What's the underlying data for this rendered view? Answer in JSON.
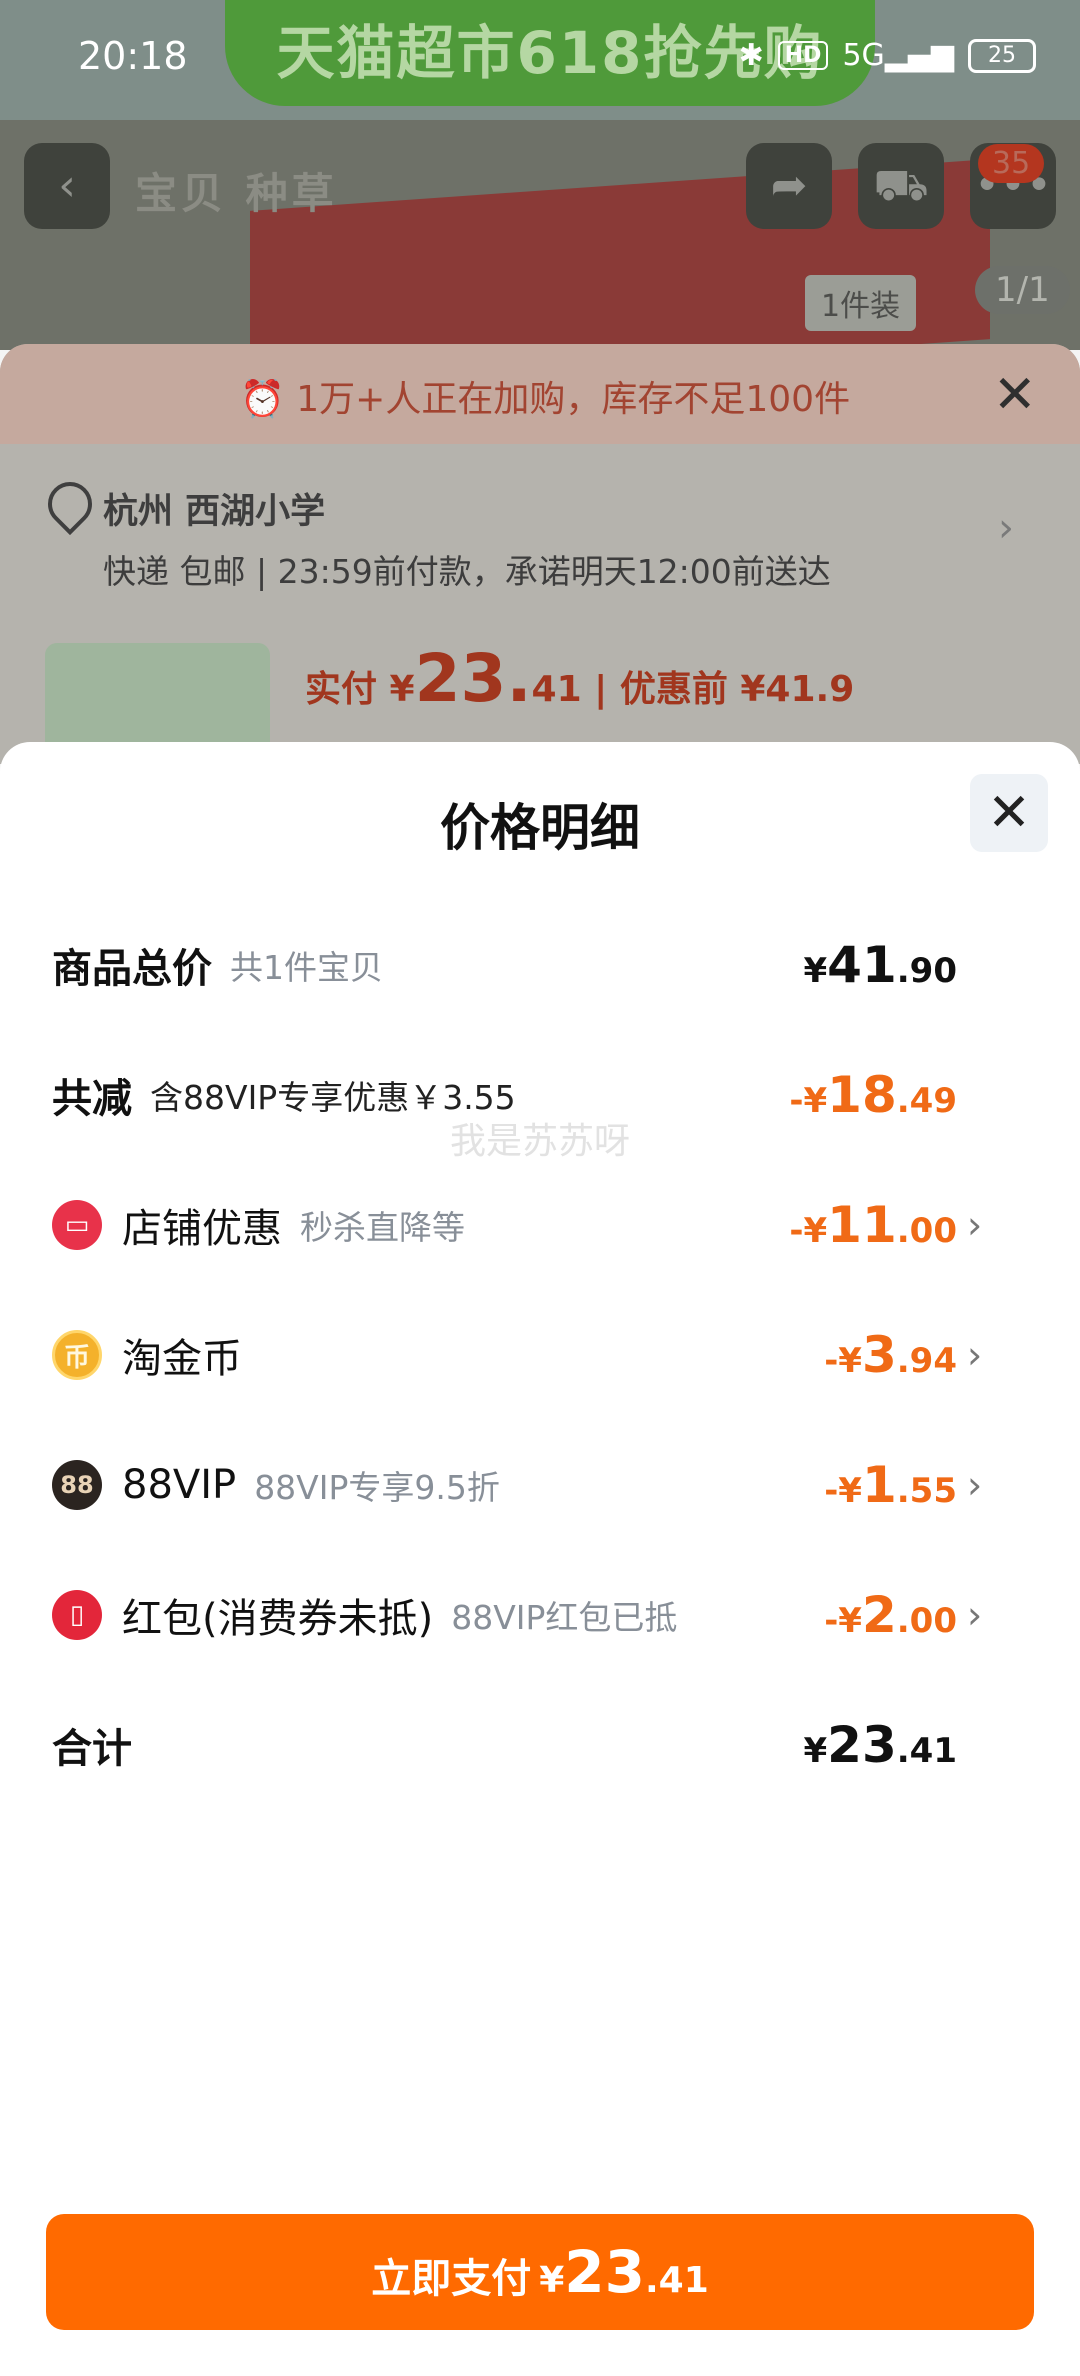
{
  "status": {
    "time": "20:18",
    "banner": "天猫超市618抢先购",
    "hd": "HD",
    "network": "5G",
    "battery": "25"
  },
  "header": {
    "title": "宝贝  种草",
    "cart_count": "35",
    "variant": "1件装",
    "page": "1/1"
  },
  "sheet": {
    "alert": "1万+人正在加购，库存不足100件",
    "address_name": "杭州 西湖小学",
    "delivery": "快递 包邮 | 23:59前付款，承诺明天12:00前送达",
    "pay_prefix": "实付 ¥",
    "pay_int": "23.",
    "pay_dec": "41",
    "pay_before": " | 优惠前 ¥41.9"
  },
  "detail": {
    "title": "价格明细",
    "rows": [
      {
        "label": "商品总价",
        "sub": "共1件宝贝",
        "cur": "¥",
        "int": "41",
        "dec": ".90"
      },
      {
        "label": "共减",
        "sub": "含88VIP专享优惠￥3.55",
        "cur": "-¥",
        "int": "18",
        "dec": ".49"
      },
      {
        "label": "店铺优惠",
        "sub": "秒杀直降等",
        "cur": "-¥",
        "int": "11",
        "dec": ".00",
        "icon": "shop-icon"
      },
      {
        "label": "淘金币",
        "sub": "",
        "cur": "-¥",
        "int": "3",
        "dec": ".94",
        "icon": "coin-icon"
      },
      {
        "label": "88VIP",
        "sub": "88VIP专享9.5折",
        "cur": "-¥",
        "int": "1",
        "dec": ".55",
        "icon": "vip-icon"
      },
      {
        "label": "红包(消费券未抵)",
        "sub": "88VIP红包已抵",
        "cur": "-¥",
        "int": "2",
        "dec": ".00",
        "icon": "red-packet-icon"
      },
      {
        "label": "合计",
        "sub": "",
        "cur": "¥",
        "int": "23",
        "dec": ".41"
      }
    ],
    "coin_glyph": "币",
    "vip_glyph": "88",
    "watermark": "我是苏苏呀"
  },
  "pay_button": {
    "label": "立即支付",
    "cur": "¥",
    "int": "23",
    "dec": ".41"
  },
  "colors": {
    "accent": "#ff6a00",
    "discount": "#f06a16"
  }
}
